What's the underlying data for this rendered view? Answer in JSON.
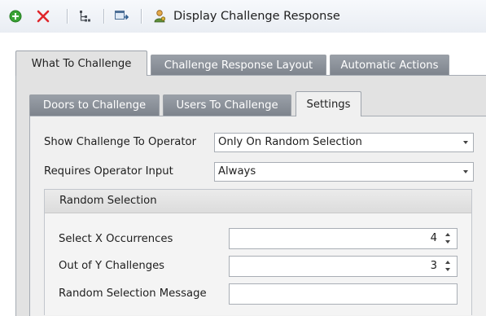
{
  "toolbar": {
    "items": [
      {
        "icon": "add-icon",
        "color": "#3aa335"
      },
      {
        "icon": "delete-icon",
        "color": "#e0262b"
      },
      {
        "icon": "hierarchy-icon"
      },
      {
        "icon": "export-icon"
      },
      {
        "icon": "user-key-icon"
      }
    ],
    "display_label": "Display Challenge Response"
  },
  "outer_tabs": [
    {
      "label": "What To Challenge",
      "active": true
    },
    {
      "label": "Challenge Response Layout",
      "active": false
    },
    {
      "label": "Automatic Actions",
      "active": false
    }
  ],
  "inner_tabs": [
    {
      "label": "Doors to Challenge",
      "active": false
    },
    {
      "label": "Users To Challenge",
      "active": false
    },
    {
      "label": "Settings",
      "active": true
    }
  ],
  "settings": {
    "show_challenge": {
      "label": "Show Challenge To Operator",
      "value": "Only On Random Selection"
    },
    "requires_input": {
      "label": "Requires Operator Input",
      "value": "Always"
    }
  },
  "random_selection": {
    "title": "Random Selection",
    "select_x": {
      "label": "Select X Occurrences",
      "value": "4"
    },
    "out_of_y": {
      "label": "Out of Y Challenges",
      "value": "3"
    },
    "message": {
      "label": "Random Selection Message",
      "value": ""
    }
  },
  "colors": {
    "tab_inactive": "#8a9099",
    "panel_background": "#f0f0f0",
    "accent_add": "#3aa335",
    "accent_delete": "#e0262b"
  }
}
